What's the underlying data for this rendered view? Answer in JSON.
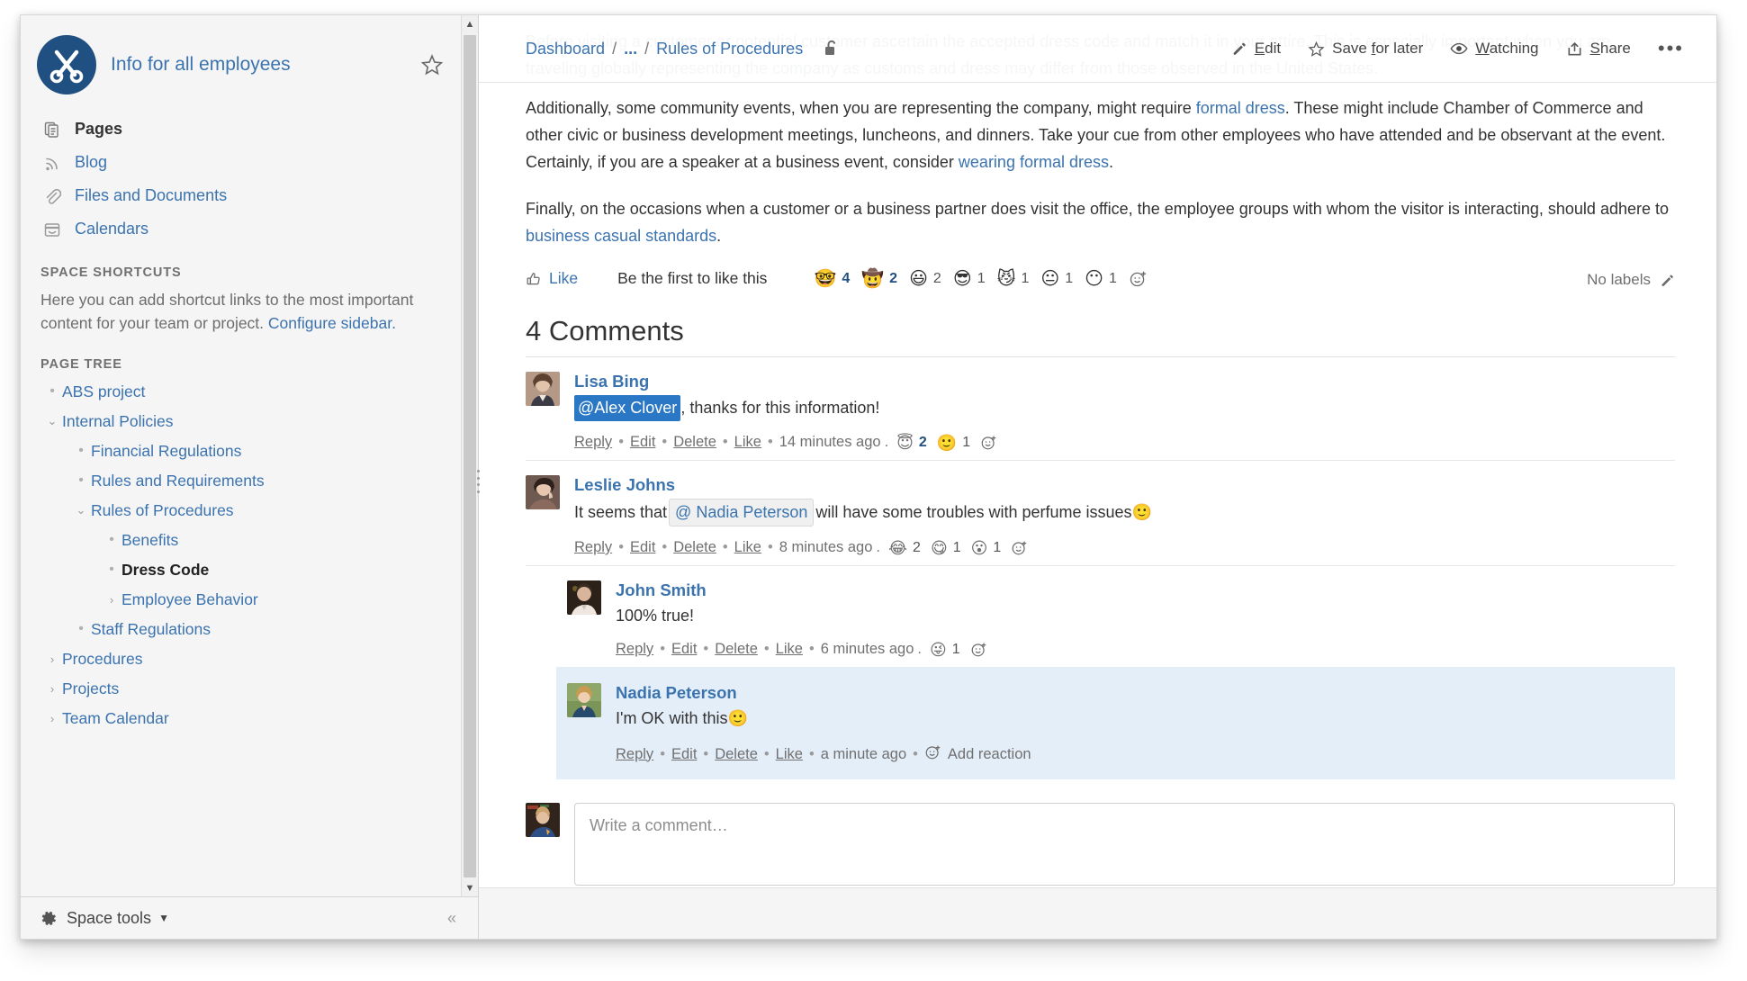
{
  "space": {
    "title": "Info for all employees",
    "logo_icon": "scissors-logo-icon",
    "star_icon": "star-icon"
  },
  "sidebar": {
    "nav": [
      {
        "label": "Pages",
        "icon": "pages-icon",
        "current": true
      },
      {
        "label": "Blog",
        "icon": "blog-rss-icon",
        "current": false
      },
      {
        "label": "Files and Documents",
        "icon": "paperclip-icon",
        "current": false
      },
      {
        "label": "Calendars",
        "icon": "calendar-icon",
        "current": false
      }
    ],
    "shortcuts_heading": "SPACE SHORTCUTS",
    "shortcuts_text": "Here you can add shortcut links to the most important content for your team or project. ",
    "shortcuts_link": "Configure sidebar.",
    "pagetree_heading": "PAGE TREE",
    "tree": [
      {
        "label": "ABS project",
        "level": 0,
        "marker": "bullet",
        "current": false
      },
      {
        "label": "Internal Policies",
        "level": 0,
        "marker": "chevron-down",
        "current": false
      },
      {
        "label": "Financial Regulations",
        "level": 1,
        "marker": "bullet",
        "current": false
      },
      {
        "label": "Rules and Requirements",
        "level": 1,
        "marker": "bullet",
        "current": false
      },
      {
        "label": "Rules of Procedures",
        "level": 1,
        "marker": "chevron-down",
        "current": false
      },
      {
        "label": "Benefits",
        "level": 2,
        "marker": "bullet",
        "current": false
      },
      {
        "label": "Dress Code",
        "level": 2,
        "marker": "bullet",
        "current": true
      },
      {
        "label": "Employee Behavior",
        "level": 2,
        "marker": "chevron-right",
        "current": false
      },
      {
        "label": "Staff Regulations",
        "level": 1,
        "marker": "bullet",
        "current": false
      },
      {
        "label": "Procedures",
        "level": 0,
        "marker": "chevron-right",
        "current": false
      },
      {
        "label": "Projects",
        "level": 0,
        "marker": "chevron-right",
        "current": false
      },
      {
        "label": "Team Calendar",
        "level": 0,
        "marker": "chevron-right",
        "current": false
      }
    ],
    "space_tools": "Space tools",
    "collapse_icon": "chevron-double-left-icon"
  },
  "header": {
    "breadcrumbs": [
      {
        "label": "Dashboard"
      },
      {
        "label": "..."
      },
      {
        "label": "Rules of Procedures"
      }
    ],
    "separator": "/",
    "lock_icon": "unlocked-padlock-icon",
    "actions": [
      {
        "label": "Edit",
        "icon": "pencil-icon",
        "underline": "E"
      },
      {
        "label": "Save for later",
        "icon": "star-outline-icon",
        "underline": "f"
      },
      {
        "label": "Watching",
        "icon": "eye-icon",
        "underline": "W"
      },
      {
        "label": "Share",
        "icon": "share-icon",
        "underline": "S"
      },
      {
        "label": "",
        "icon": "ellipsis-icon",
        "underline": ""
      }
    ]
  },
  "ghost_text": "Before visiting a customer or potential customer ascertain the accepted dress code and match it in your attire. This is especially important when you are traveling globally representing the company as customs and dress may differ from those observed in the United States.",
  "content": {
    "paragraph1_a": "Additionally, some community events, when you are representing the company, might require ",
    "paragraph1_link1": "formal dress",
    "paragraph1_b": ". These might include Chamber of Commerce and other civic or business development meetings, luncheons, and dinners. Take your cue from other employees who have attended and be observant at the event. Certainly, if you are a speaker at a business event, consider ",
    "paragraph1_link2": "wearing formal dress",
    "paragraph1_c": ".",
    "paragraph2_a": "Finally, on the occasions when a customer or a business partner does visit the office, the employee groups with whom the visitor is interacting, should adhere to ",
    "paragraph2_link1": "business casual standards",
    "paragraph2_b": "."
  },
  "like_row": {
    "like_label": "Like",
    "like_icon": "thumbs-up-icon",
    "status": "Be the first to like this",
    "reactions": [
      {
        "emoji": "🤓",
        "name": "nerd-face-reaction",
        "count": "4",
        "hot": true
      },
      {
        "emoji": "🤠",
        "name": "cowboy-face-reaction",
        "count": "2",
        "hot": true
      },
      {
        "emoji": "😃",
        "name": "grinning-face-reaction",
        "count": "2",
        "hot": false
      },
      {
        "emoji": "😎",
        "name": "sunglasses-face-reaction",
        "count": "1",
        "hot": false
      },
      {
        "emoji": "😼",
        "name": "wry-cat-face-reaction",
        "count": "1",
        "hot": false
      },
      {
        "emoji": "😐",
        "name": "neutral-face-reaction",
        "count": "1",
        "hot": false
      },
      {
        "emoji": "😶",
        "name": "no-mouth-face-reaction",
        "count": "1",
        "hot": false
      }
    ],
    "add_reaction_icon": "add-reaction-icon",
    "labels_text": "No labels",
    "labels_edit_icon": "pencil-icon"
  },
  "comments": {
    "heading": "4 Comments",
    "items": [
      {
        "author": "Lisa Bing",
        "avatar_name": "avatar-lisa-bing",
        "avatar_colors": [
          "#c9a88f",
          "#6b4f3a",
          "#e3d2c3"
        ],
        "text_before": "",
        "mention": "@Alex Clover",
        "mention_style": "selected",
        "text_after": ", thanks for this information!",
        "emoji_suffix": "",
        "actions": [
          "Reply",
          "Edit",
          "Delete",
          "Like"
        ],
        "time": "14 minutes ago",
        "reactions": [
          {
            "emoji": "😇",
            "name": "halo-face-reaction",
            "count": "2",
            "hot": true
          },
          {
            "emoji": "🙂",
            "name": "slight-smile-reaction",
            "count": "1",
            "hot": false
          }
        ],
        "add_reaction": "",
        "indent": false,
        "highlight": false
      },
      {
        "author": "Leslie Johns",
        "avatar_name": "avatar-leslie-johns",
        "avatar_colors": [
          "#8a6a5c",
          "#3c2b24",
          "#d8c0b2"
        ],
        "text_before": "It seems that ",
        "mention": "@ Nadia Peterson",
        "mention_style": "chip",
        "text_after": " will have some troubles with perfume issues ",
        "emoji_suffix": "🙂",
        "actions": [
          "Reply",
          "Edit",
          "Delete",
          "Like"
        ],
        "time": "8 minutes ago",
        "reactions": [
          {
            "emoji": "😂",
            "name": "joy-face-reaction",
            "count": "2",
            "hot": false
          },
          {
            "emoji": "😋",
            "name": "yum-face-reaction",
            "count": "1",
            "hot": false
          },
          {
            "emoji": "😮",
            "name": "surprised-face-reaction",
            "count": "1",
            "hot": false
          }
        ],
        "add_reaction": "",
        "indent": false,
        "highlight": false
      },
      {
        "author": "John Smith",
        "avatar_name": "avatar-john-smith",
        "avatar_colors": [
          "#4a3a30",
          "#d8b49a",
          "#efe6df"
        ],
        "text_before": "100% true!",
        "mention": "",
        "mention_style": "none",
        "text_after": "",
        "emoji_suffix": "",
        "actions": [
          "Reply",
          "Edit",
          "Delete",
          "Like"
        ],
        "time": "6 minutes ago",
        "reactions": [
          {
            "emoji": "😜",
            "name": "tongue-wink-face-reaction",
            "count": "1",
            "hot": false
          }
        ],
        "add_reaction": "",
        "indent": true,
        "highlight": false
      },
      {
        "author": "Nadia Peterson",
        "avatar_name": "avatar-nadia-peterson",
        "avatar_colors": [
          "#7d9a5e",
          "#2f4d6b",
          "#e6dfc9"
        ],
        "text_before": "I'm OK with this ",
        "mention": "",
        "mention_style": "none",
        "text_after": "",
        "emoji_suffix": "🙂",
        "actions": [
          "Reply",
          "Edit",
          "Delete",
          "Like"
        ],
        "time": "a minute ago",
        "reactions": [],
        "add_reaction": "Add reaction",
        "indent": true,
        "highlight": true
      }
    ]
  },
  "new_comment": {
    "placeholder": "Write a comment…",
    "avatar_name": "avatar-current-user"
  }
}
